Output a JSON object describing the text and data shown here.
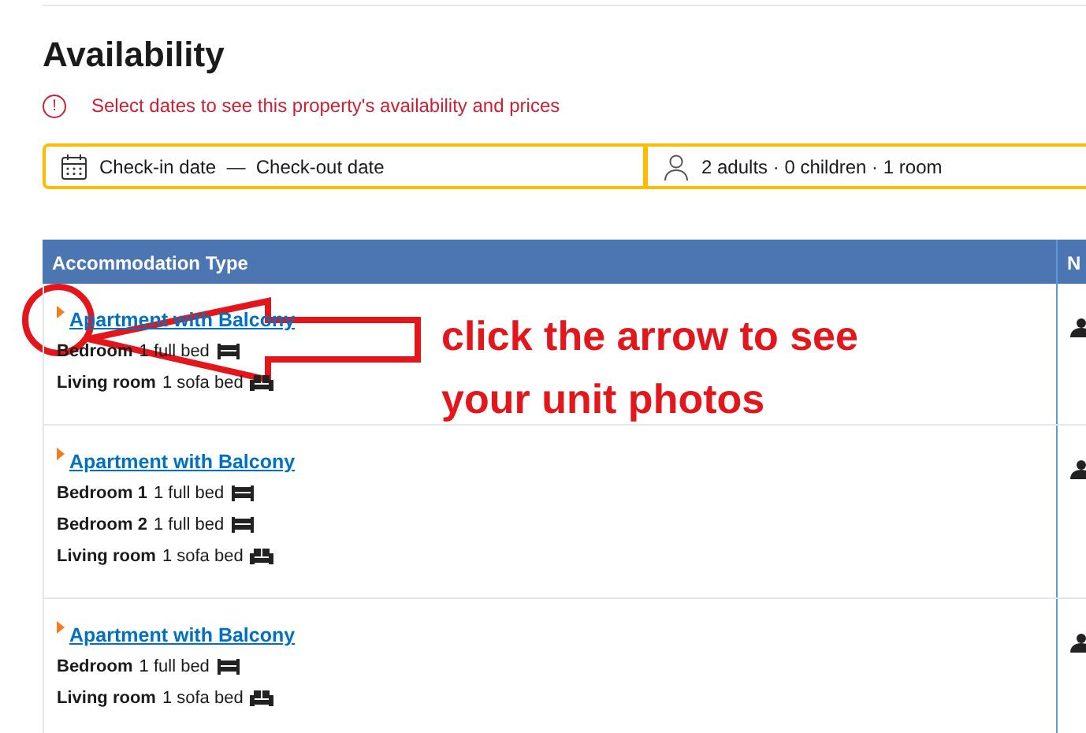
{
  "title": "Availability",
  "notice": {
    "icon": "!",
    "text": "Select dates to see this property's availability and prices"
  },
  "search": {
    "dates": "Check-in date  —  Check-out date",
    "guests": "2 adults · 0 children · 1 room"
  },
  "table": {
    "columns": [
      "Accommodation Type",
      "N"
    ],
    "rows": [
      {
        "name": "Apartment with Balcony",
        "beds": [
          {
            "room": "Bedroom",
            "bed": "1 full bed",
            "kind": "full"
          },
          {
            "room": "Living room",
            "bed": "1 sofa bed",
            "kind": "sofa"
          }
        ]
      },
      {
        "name": "Apartment with Balcony",
        "beds": [
          {
            "room": "Bedroom 1",
            "bed": "1 full bed",
            "kind": "full"
          },
          {
            "room": "Bedroom 2",
            "bed": "1 full bed",
            "kind": "full"
          },
          {
            "room": "Living room",
            "bed": "1 sofa bed",
            "kind": "sofa"
          }
        ]
      },
      {
        "name": "Apartment with Balcony",
        "beds": [
          {
            "room": "Bedroom",
            "bed": "1 full bed",
            "kind": "full"
          },
          {
            "room": "Living room",
            "bed": "1 sofa bed",
            "kind": "sofa"
          }
        ]
      }
    ]
  },
  "annotation": {
    "lines": [
      "click the arrow to see",
      "your unit photos"
    ]
  }
}
